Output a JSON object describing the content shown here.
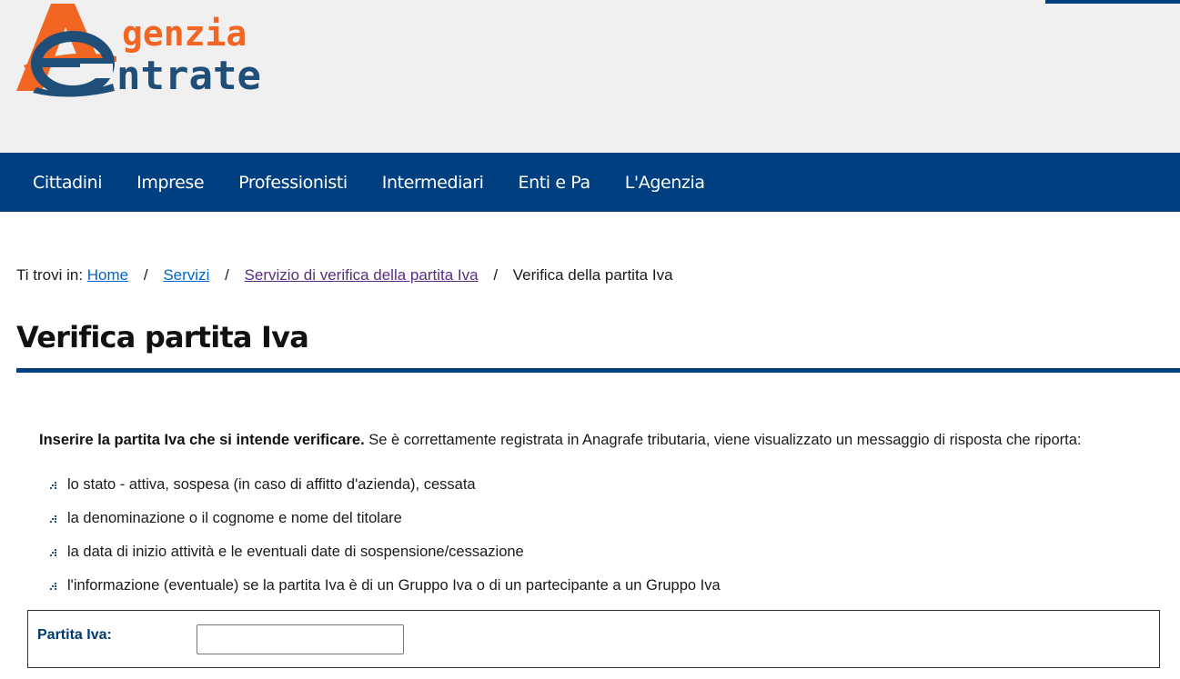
{
  "header": {
    "logo_text_top": "genzia",
    "logo_text_bottom": "ntrate",
    "colors": {
      "orange": "#f26522",
      "blue": "#1f4e79",
      "nav": "#004080"
    }
  },
  "nav": {
    "items": [
      {
        "label": "Cittadini"
      },
      {
        "label": "Imprese"
      },
      {
        "label": "Professionisti"
      },
      {
        "label": "Intermediari"
      },
      {
        "label": "Enti e Pa"
      },
      {
        "label": "L'Agenzia"
      }
    ]
  },
  "breadcrumb": {
    "prefix": "Ti trovi in:",
    "items": [
      {
        "label": "Home"
      },
      {
        "label": "Servizi"
      },
      {
        "label": "Servizio di verifica della partita Iva"
      },
      {
        "label": "Verifica della partita Iva"
      }
    ],
    "separator": "/"
  },
  "page": {
    "title": "Verifica partita Iva",
    "intro_bold": "Inserire la partita Iva che si intende verificare.",
    "intro_rest": " Se è correttamente registrata in Anagrafe tributaria, viene visualizzato un messaggio di risposta che riporta:",
    "bullets": [
      "lo stato - attiva, sospesa (in caso di affitto d'azienda), cessata",
      "la denominazione o il cognome e nome del titolare",
      "la data di inizio attività e le eventuali date di sospensione/cessazione",
      "l'informazione (eventuale) se la partita Iva è di un Gruppo Iva o di un partecipante a un Gruppo Iva"
    ]
  },
  "form": {
    "label": "Partita Iva:",
    "value": ""
  }
}
